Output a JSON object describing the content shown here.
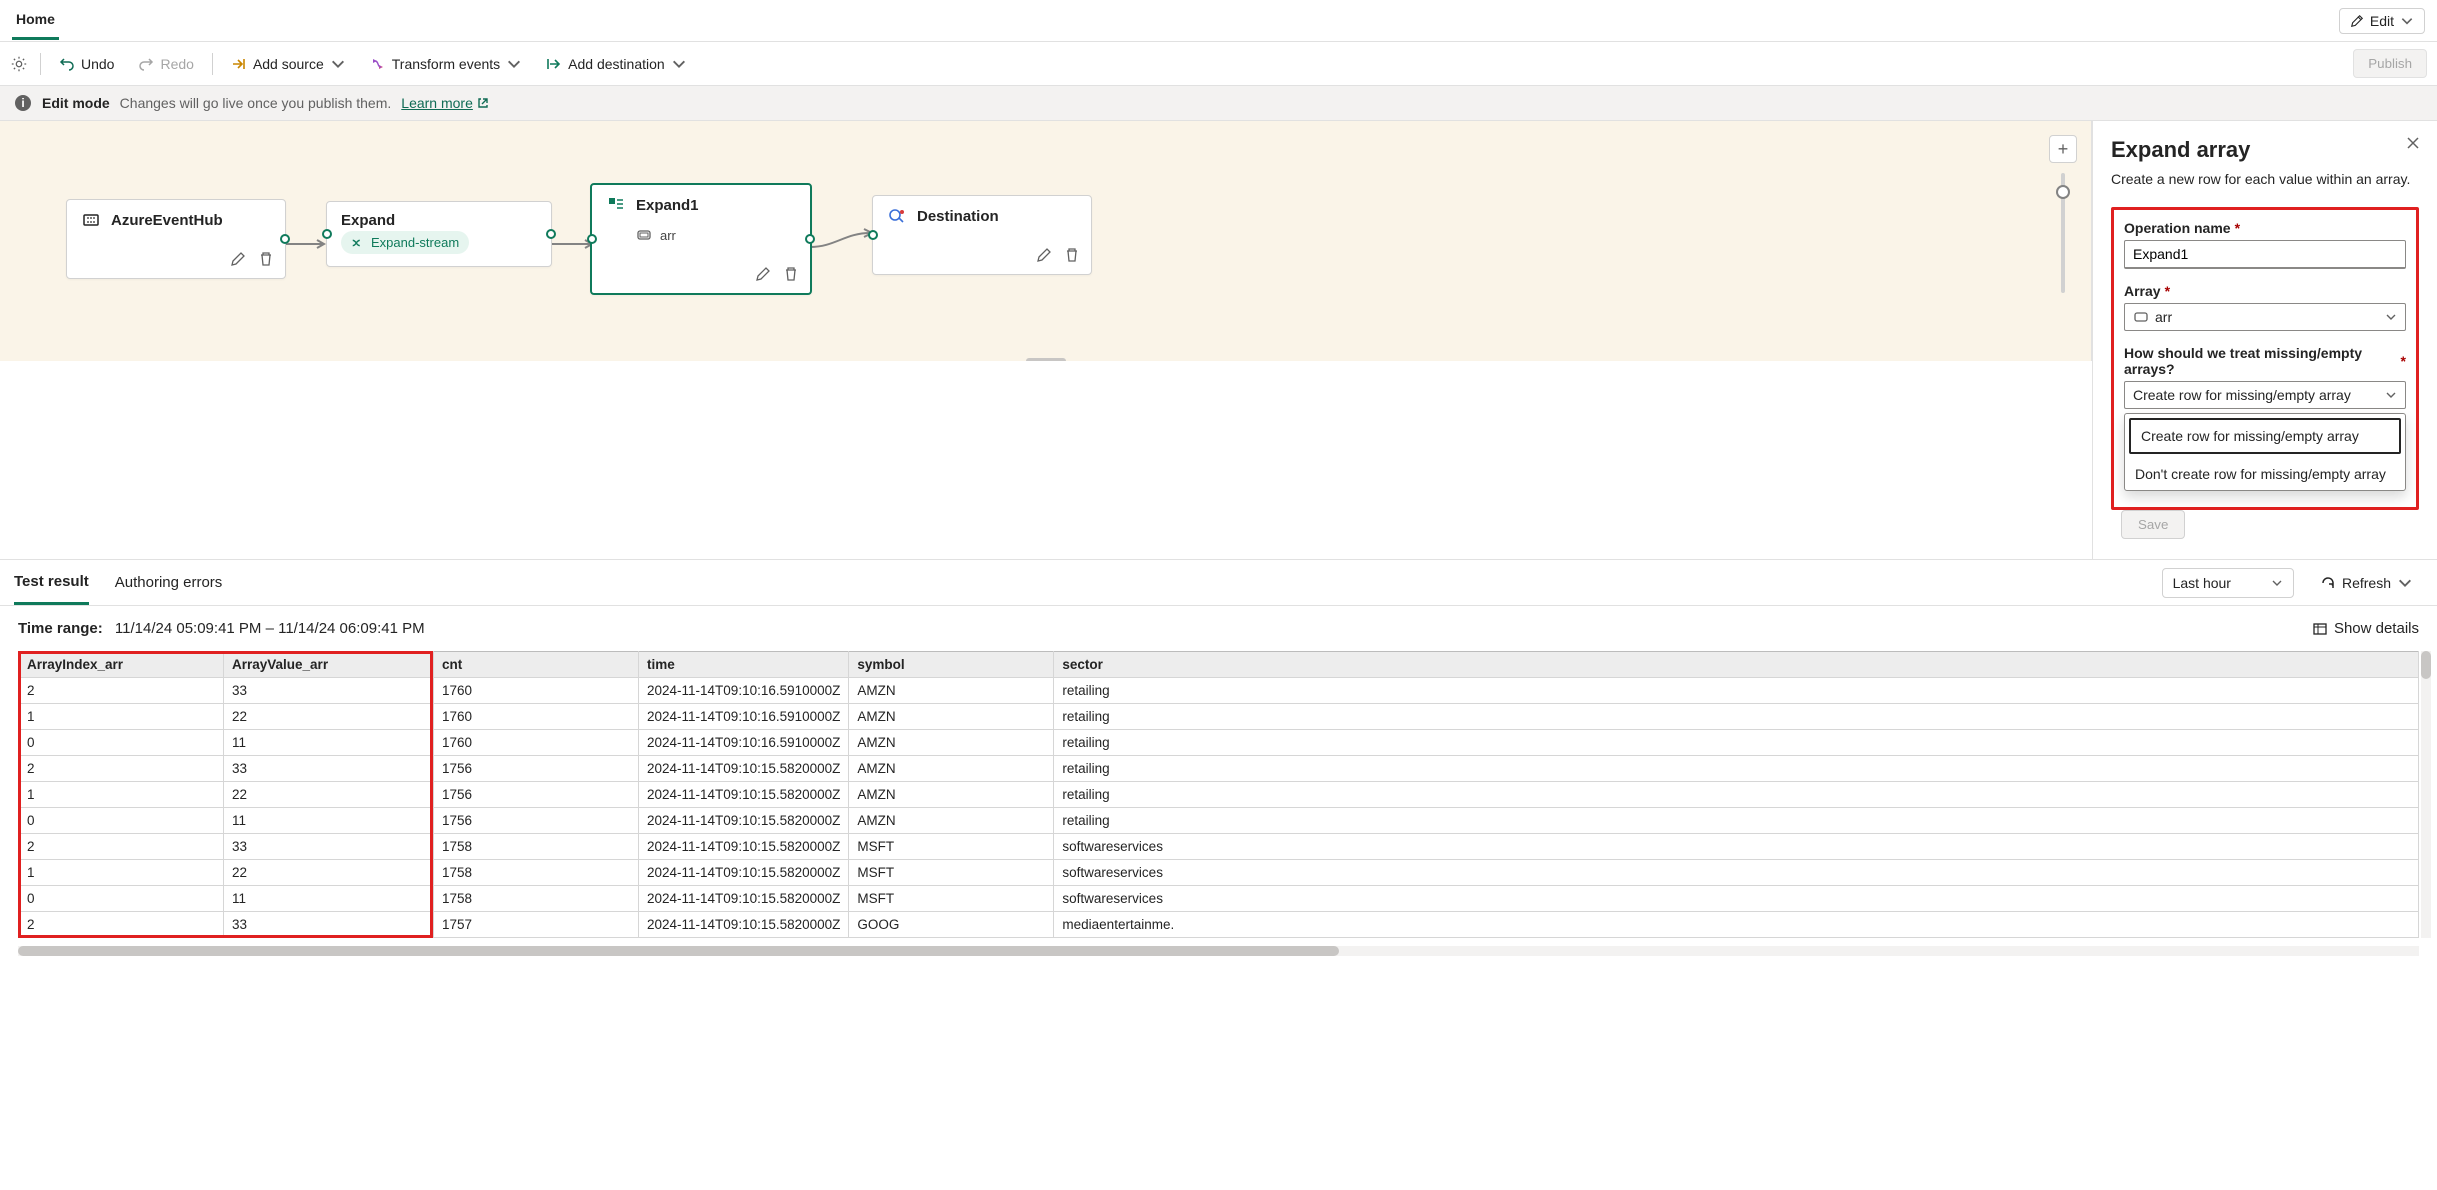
{
  "breadcrumb": {
    "home": "Home"
  },
  "editBtn": {
    "label": "Edit"
  },
  "toolbar": {
    "undo": "Undo",
    "redo": "Redo",
    "addSource": "Add source",
    "transform": "Transform events",
    "addDest": "Add destination",
    "publish": "Publish"
  },
  "info": {
    "mode": "Edit mode",
    "sub": "Changes will go live once you publish them.",
    "link": "Learn more"
  },
  "nodes": {
    "source": {
      "title": "AzureEventHub"
    },
    "expand": {
      "title": "Expand",
      "chip": "Expand-stream"
    },
    "expand1": {
      "title": "Expand1",
      "field": "arr"
    },
    "dest": {
      "title": "Destination"
    }
  },
  "side": {
    "title": "Expand array",
    "desc": "Create a new row for each value within an array.",
    "op_label": "Operation name",
    "op_value": "Expand1",
    "arr_label": "Array",
    "arr_value": "arr",
    "miss_label": "How should we treat missing/empty arrays?",
    "miss_value": "Create row for missing/empty array",
    "dd1": "Create row for missing/empty array",
    "dd2": "Don't create row for missing/empty array",
    "save": "Save"
  },
  "tabs": {
    "test": "Test result",
    "errors": "Authoring errors",
    "range": "Last hour",
    "refresh": "Refresh"
  },
  "meta": {
    "key": "Time range:",
    "val": "11/14/24 05:09:41 PM – 11/14/24 06:09:41 PM",
    "details": "Show details"
  },
  "table": {
    "headers": [
      "ArrayIndex_arr",
      "ArrayValue_arr",
      "cnt",
      "time",
      "symbol",
      "sector"
    ],
    "rows": [
      [
        "2",
        "33",
        "1760",
        "2024-11-14T09:10:16.5910000Z",
        "AMZN",
        "retailing"
      ],
      [
        "1",
        "22",
        "1760",
        "2024-11-14T09:10:16.5910000Z",
        "AMZN",
        "retailing"
      ],
      [
        "0",
        "11",
        "1760",
        "2024-11-14T09:10:16.5910000Z",
        "AMZN",
        "retailing"
      ],
      [
        "2",
        "33",
        "1756",
        "2024-11-14T09:10:15.5820000Z",
        "AMZN",
        "retailing"
      ],
      [
        "1",
        "22",
        "1756",
        "2024-11-14T09:10:15.5820000Z",
        "AMZN",
        "retailing"
      ],
      [
        "0",
        "11",
        "1756",
        "2024-11-14T09:10:15.5820000Z",
        "AMZN",
        "retailing"
      ],
      [
        "2",
        "33",
        "1758",
        "2024-11-14T09:10:15.5820000Z",
        "MSFT",
        "softwareservices"
      ],
      [
        "1",
        "22",
        "1758",
        "2024-11-14T09:10:15.5820000Z",
        "MSFT",
        "softwareservices"
      ],
      [
        "0",
        "11",
        "1758",
        "2024-11-14T09:10:15.5820000Z",
        "MSFT",
        "softwareservices"
      ],
      [
        "2",
        "33",
        "1757",
        "2024-11-14T09:10:15.5820000Z",
        "GOOG",
        "mediaentertainme."
      ]
    ]
  }
}
